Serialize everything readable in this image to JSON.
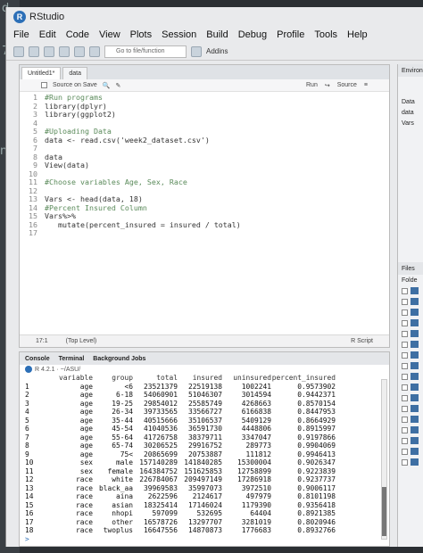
{
  "window": {
    "title": "RStudio"
  },
  "background_fragments": [
    "d",
    "7",
    "1",
    "ne"
  ],
  "menu": [
    "File",
    "Edit",
    "Code",
    "View",
    "Plots",
    "Session",
    "Build",
    "Debug",
    "Profile",
    "Tools",
    "Help"
  ],
  "toolbar": {
    "goto_placeholder": "Go to file/function",
    "addins_label": "Addins"
  },
  "editor": {
    "tabs": [
      {
        "label": "Untitled1*",
        "active": true
      },
      {
        "label": "data",
        "active": false
      }
    ],
    "source_on_save_label": "Source on Save",
    "run_label": "Run",
    "source_label": "Source",
    "lines": [
      "#Run programs",
      "library(dplyr)",
      "library(ggplot2)",
      "",
      "#Uploading Data",
      "data <- read.csv('week2_dataset.csv')",
      "",
      "data",
      "View(data)",
      "",
      "#Choose variables Age, Sex, Race",
      "",
      "Vars <- head(data, 18)",
      "#Percent Insured Column",
      "Vars%>%",
      "   mutate(percent_insured = insured / total)",
      ""
    ],
    "status_position": "17:1",
    "status_scope": "(Top Level)",
    "status_type": "R Script"
  },
  "console": {
    "tabs": [
      "Console",
      "Terminal",
      "Background Jobs"
    ],
    "path": "R 4.2.1 · ~/ASU/",
    "header": [
      "variable",
      "group",
      "total",
      "insured",
      "uninsured",
      "percent_insured"
    ],
    "rows": [
      [
        "1",
        "age",
        "<6",
        "23521379",
        "22519138",
        "1002241",
        "0.9573902"
      ],
      [
        "2",
        "age",
        "6-18",
        "54060901",
        "51046307",
        "3014594",
        "0.9442371"
      ],
      [
        "3",
        "age",
        "19-25",
        "29854012",
        "25585749",
        "4268663",
        "0.8570154"
      ],
      [
        "4",
        "age",
        "26-34",
        "39733565",
        "33566727",
        "6166838",
        "0.8447953"
      ],
      [
        "5",
        "age",
        "35-44",
        "40515666",
        "35106537",
        "5409129",
        "0.8664929"
      ],
      [
        "6",
        "age",
        "45-54",
        "41040536",
        "36591730",
        "4448806",
        "0.8915997"
      ],
      [
        "7",
        "age",
        "55-64",
        "41726758",
        "38379711",
        "3347047",
        "0.9197866"
      ],
      [
        "8",
        "age",
        "65-74",
        "30206525",
        "29916752",
        "289773",
        "0.9904069"
      ],
      [
        "9",
        "age",
        "75<",
        "20865699",
        "20753887",
        "111812",
        "0.9946413"
      ],
      [
        "10",
        "sex",
        "male",
        "157140289",
        "141840285",
        "15300004",
        "0.9026347"
      ],
      [
        "11",
        "sex",
        "female",
        "164384752",
        "151625853",
        "12758899",
        "0.9223839"
      ],
      [
        "12",
        "race",
        "white",
        "226784067",
        "209497149",
        "17286918",
        "0.9237737"
      ],
      [
        "13",
        "race",
        "black_aa",
        "39969583",
        "35997073",
        "3972510",
        "0.9006117"
      ],
      [
        "14",
        "race",
        "aina",
        "2622596",
        "2124617",
        "497979",
        "0.8101198"
      ],
      [
        "15",
        "race",
        "asian",
        "18325414",
        "17146024",
        "1179390",
        "0.9356418"
      ],
      [
        "16",
        "race",
        "nhopi",
        "597099",
        "532695",
        "64404",
        "0.8921385"
      ],
      [
        "17",
        "race",
        "other",
        "16578726",
        "13297707",
        "3281019",
        "0.8020946"
      ],
      [
        "18",
        "race",
        "twoplus",
        "16647556",
        "14870873",
        "1776683",
        "0.8932766"
      ]
    ],
    "prompt": ">"
  },
  "right_pane": {
    "env_tab": "Environ",
    "data_label": "Data",
    "items": [
      "data",
      "Vars"
    ],
    "files_tab": "Files",
    "folder_label": "Folde"
  }
}
